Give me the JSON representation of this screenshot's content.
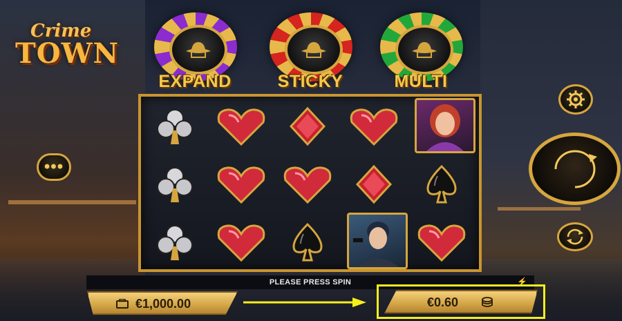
{
  "game": {
    "logo_line1": "Crime",
    "logo_line2": "TOWN"
  },
  "features": [
    {
      "label": "EXPAND",
      "color": "#8a2ccf"
    },
    {
      "label": "STICKY",
      "color": "#d6241e"
    },
    {
      "label": "MULTI",
      "color": "#22a83a"
    }
  ],
  "reels": {
    "grid": [
      [
        "club",
        "heart",
        "diamond",
        "heart",
        "woman-portrait"
      ],
      [
        "club",
        "heart",
        "heart",
        "diamond",
        "spade"
      ],
      [
        "club",
        "heart",
        "spade",
        "man-portrait",
        "heart"
      ]
    ]
  },
  "status": {
    "message": "PLEASE PRESS SPIN"
  },
  "balance": {
    "value": "€1,000.00",
    "icon": "wallet-icon"
  },
  "bet": {
    "value": "€0.60",
    "icon": "coins-icon"
  },
  "controls": {
    "menu_icon": "more-dots-icon",
    "settings_icon": "gear-icon",
    "spin_icon": "spin-icon",
    "autoplay_icon": "autoplay-icon"
  },
  "colors": {
    "gold": "#d6a63e",
    "highlight": "#f5ee1d"
  }
}
